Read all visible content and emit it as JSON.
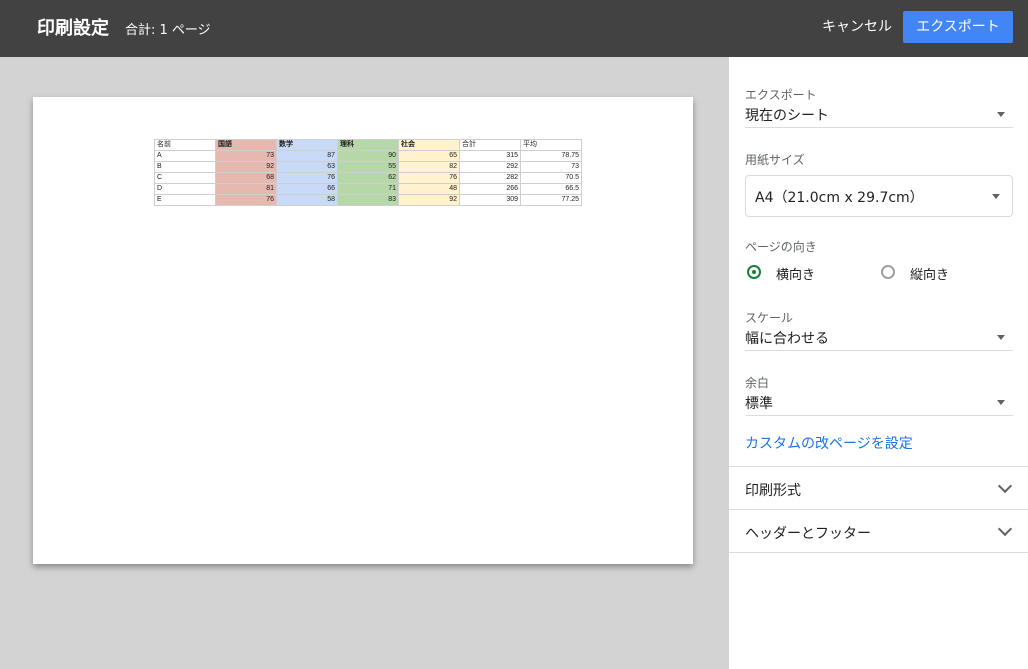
{
  "header": {
    "title": "印刷設定",
    "subtitle": "合計: 1 ページ",
    "cancel_label": "キャンセル",
    "export_label": "エクスポート"
  },
  "sheet": {
    "headers": [
      "名前",
      "国語",
      "数学",
      "理科",
      "社会",
      "合計",
      "平均"
    ],
    "rows": [
      [
        "A",
        "73",
        "87",
        "90",
        "65",
        "315",
        "78.75"
      ],
      [
        "B",
        "92",
        "63",
        "55",
        "82",
        "292",
        "73"
      ],
      [
        "C",
        "68",
        "76",
        "62",
        "76",
        "282",
        "70.5"
      ],
      [
        "D",
        "81",
        "66",
        "71",
        "48",
        "266",
        "66.5"
      ],
      [
        "E",
        "76",
        "58",
        "83",
        "92",
        "309",
        "77.25"
      ]
    ],
    "column_colors": [
      "#ffffff",
      "#e6b8af",
      "#c9daf8",
      "#b6d7a8",
      "#fff2cc",
      "#ffffff",
      "#ffffff"
    ]
  },
  "panel": {
    "export_label": "エクスポート",
    "export_value": "現在のシート",
    "paper_label": "用紙サイズ",
    "paper_value": "A4（21.0cm x 29.7cm）",
    "orientation_label": "ページの向き",
    "landscape_label": "横向き",
    "portrait_label": "縦向き",
    "orientation_selected": "landscape",
    "scale_label": "スケール",
    "scale_value": "幅に合わせる",
    "margin_label": "余白",
    "margin_value": "標準",
    "custom_break_link": "カスタムの改ページを設定",
    "print_format_label": "印刷形式",
    "header_footer_label": "ヘッダーとフッター"
  },
  "colors": {
    "topbar": "#424242",
    "accent": "#4285f4",
    "link": "#1a73e8",
    "radio_on": "#188038"
  }
}
